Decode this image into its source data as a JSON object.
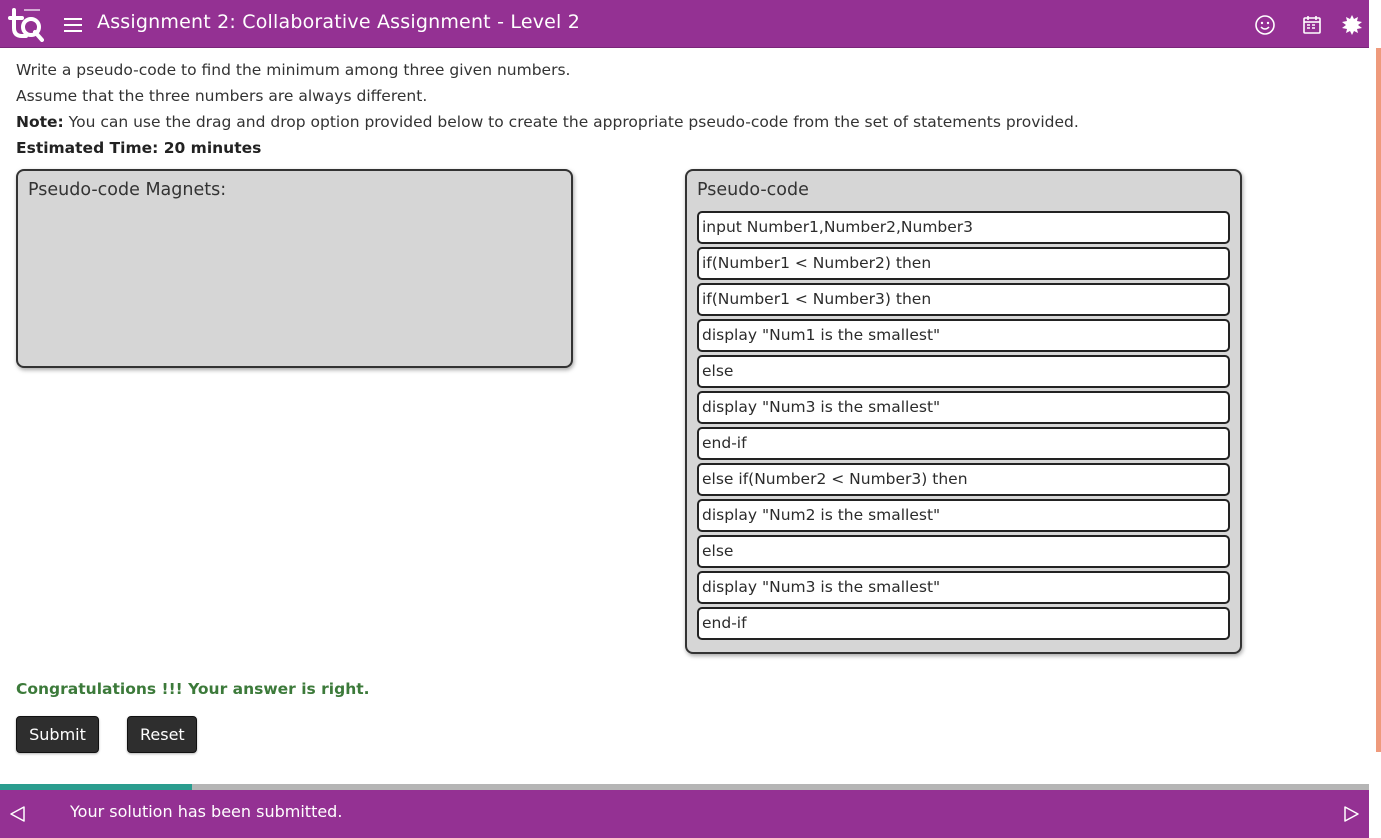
{
  "header": {
    "title": "Assignment 2: Collaborative Assignment - Level 2",
    "icons": [
      "logo-icon",
      "menu-icon",
      "smiley-icon",
      "calendar-icon",
      "settings-icon"
    ]
  },
  "instructions": {
    "line1": "Write a pseudo-code to find the minimum among three given numbers.",
    "line2": "Assume that the three numbers are always different.",
    "note_label": "Note:",
    "note_text": " You can use the drag and drop option provided below to create the appropriate pseudo-code from the set of statements provided.",
    "estimated_time": "Estimated Time: 20 minutes"
  },
  "magnets_panel": {
    "title": "Pseudo-code Magnets:",
    "items": []
  },
  "code_panel": {
    "title": "Pseudo-code",
    "lines": [
      "input Number1,Number2,Number3",
      "if(Number1 < Number2) then",
      "if(Number1 < Number3) then",
      "display \"Num1 is the smallest\"",
      "else",
      "display \"Num3 is the smallest\"",
      "end-if",
      "else if(Number2 < Number3) then",
      "display \"Num2 is the smallest\"",
      "else",
      "display \"Num3 is the smallest\"",
      "end-if"
    ]
  },
  "result": {
    "message": "Congratulations !!! Your answer is right."
  },
  "buttons": {
    "submit_label": "Submit",
    "reset_label": "Reset"
  },
  "progress": {
    "fraction": 0.14
  },
  "footer": {
    "message": "Your solution has been submitted."
  },
  "colors": {
    "brand_purple": "#943193",
    "success_green": "#3c7a3a",
    "progress_teal": "#2a9d8f",
    "accent_orange": "#ef9a7c"
  }
}
